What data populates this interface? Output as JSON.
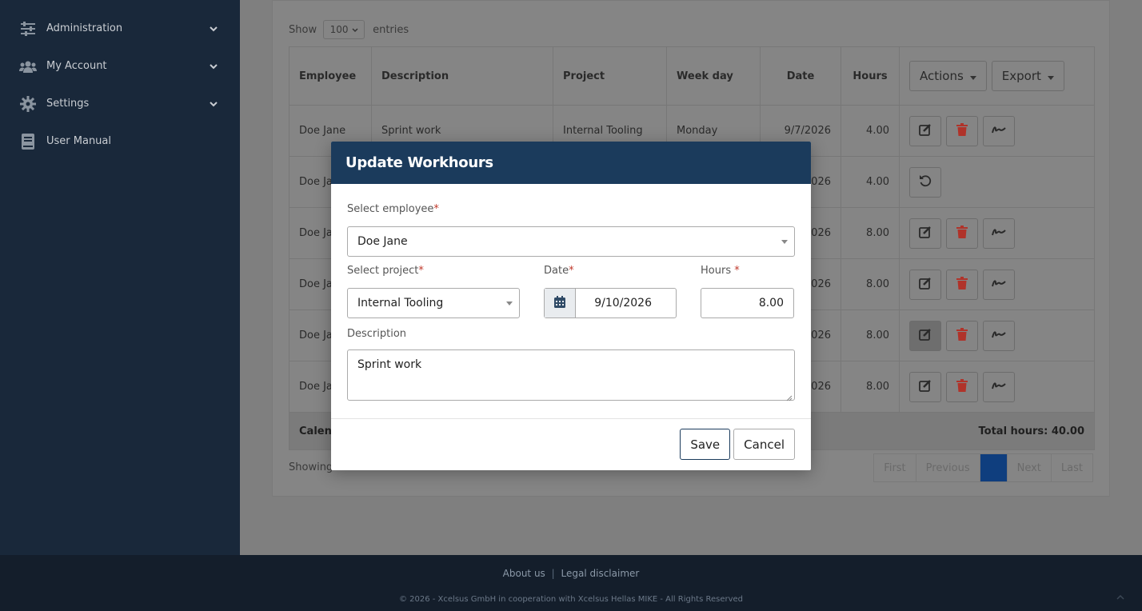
{
  "sidebar": {
    "items": [
      {
        "label": "Administration",
        "icon": "sliders-icon",
        "has_chevron": true
      },
      {
        "label": "My Account",
        "icon": "users-icon",
        "has_chevron": true
      },
      {
        "label": "Settings",
        "icon": "gear-icon",
        "has_chevron": true
      },
      {
        "label": "User Manual",
        "icon": "book-icon",
        "has_chevron": false
      }
    ]
  },
  "table_controls": {
    "show_label": "Show",
    "entries_value": "100",
    "entries_label": "entries"
  },
  "table": {
    "headers": [
      "Employee",
      "Description",
      "Project",
      "Week day",
      "Date",
      "Hours"
    ],
    "actions_label": "Actions",
    "export_label": "Export",
    "rows": [
      {
        "employee": "Doe Jane",
        "description": "Sprint work",
        "project": "Internal Tooling",
        "weekday": "Monday",
        "date": "9/7/2026",
        "hours": "4.00"
      },
      {
        "employee": "Doe Ja",
        "description": "",
        "project": "",
        "weekday": "",
        "date": "026",
        "hours": "4.00"
      },
      {
        "employee": "Doe Ja",
        "description": "",
        "project": "",
        "weekday": "",
        "date": "026",
        "hours": "8.00"
      },
      {
        "employee": "Doe Ja",
        "description": "",
        "project": "",
        "weekday": "",
        "date": "026",
        "hours": "8.00"
      },
      {
        "employee": "Doe Ja",
        "description": "",
        "project": "",
        "weekday": "",
        "date": "026",
        "hours": "8.00"
      },
      {
        "employee": "Doe Ja",
        "description": "",
        "project": "",
        "weekday": "",
        "date": "026",
        "hours": "8.00"
      }
    ],
    "footer_left": "Calen",
    "footer_right": "Total hours: 40.00"
  },
  "showing_text": "Showing",
  "pagination": {
    "first": "First",
    "previous": "Previous",
    "current": "",
    "next": "Next",
    "last": "Last"
  },
  "footer": {
    "about": "About us",
    "separator": "|",
    "legal": "Legal disclaimer",
    "copyright": "© 2026 - Xcelsus GmbH in cooperation with Xcelsus Hellas MIKE - All Rights Reserved"
  },
  "modal": {
    "title": "Update Workhours",
    "employee_label": "Select employee",
    "employee_value": "Doe Jane",
    "project_label": "Select project",
    "project_value": "Internal Tooling",
    "date_label": "Date",
    "date_value": "9/10/2026",
    "hours_label": "Hours",
    "hours_value": "8.00",
    "description_label": "Description",
    "description_value": "Sprint work",
    "required_mark": "*",
    "save_label": "Save",
    "cancel_label": "Cancel"
  },
  "colors": {
    "sidebar_bg": "#19283a",
    "modal_header_bg": "#1b3b5c",
    "required": "#c0392b",
    "delete_red": "#b0332a"
  }
}
